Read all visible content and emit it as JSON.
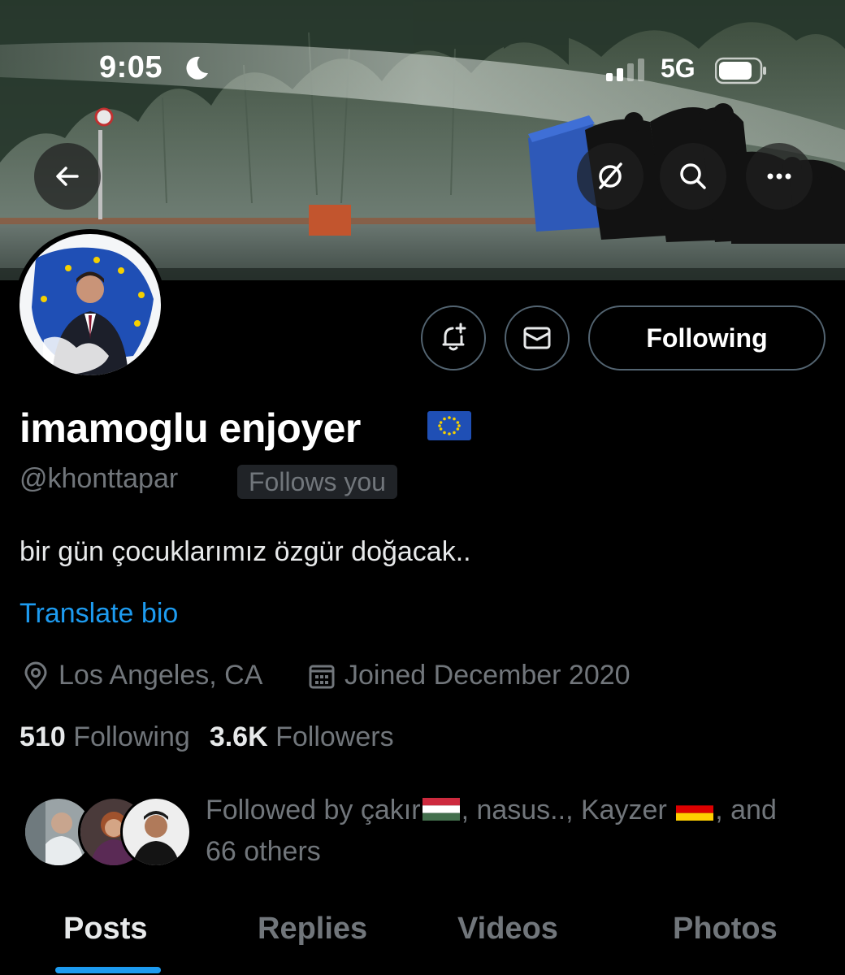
{
  "status_bar": {
    "time": "9:05",
    "network": "5G"
  },
  "header": {
    "back_icon": "arrow-left-icon",
    "grok_icon": "grok-icon",
    "search_icon": "search-icon",
    "more_icon": "ellipsis-icon"
  },
  "actions": {
    "notify_icon": "bell-plus-icon",
    "message_icon": "envelope-icon",
    "following_label": "Following"
  },
  "profile": {
    "display_name": "imamoglu enjoyer",
    "handle": "@khonttapar",
    "follows_you": "Follows you",
    "bio": "bir gün çocuklarımız özgür doğacak..",
    "translate_label": "Translate bio",
    "location": "Los Angeles, CA",
    "joined": "Joined December 2020",
    "following_count": "510",
    "following_label": "Following",
    "followers_count": "3.6K",
    "followers_label": "Followers"
  },
  "followed_by": {
    "prefix": "Followed by ",
    "name1": "çakır",
    "sep1": ", nasus.., Kayzer ",
    "suffix1": ", and",
    "line2": "66 others"
  },
  "tabs": [
    {
      "label": "Posts",
      "active": true
    },
    {
      "label": "Replies",
      "active": false
    },
    {
      "label": "Videos",
      "active": false
    },
    {
      "label": "Photos",
      "active": false
    }
  ],
  "colors": {
    "background": "#000000",
    "accent": "#1d9bf0",
    "muted": "#71767b",
    "text": "#e7e9ea",
    "border": "#536471"
  }
}
